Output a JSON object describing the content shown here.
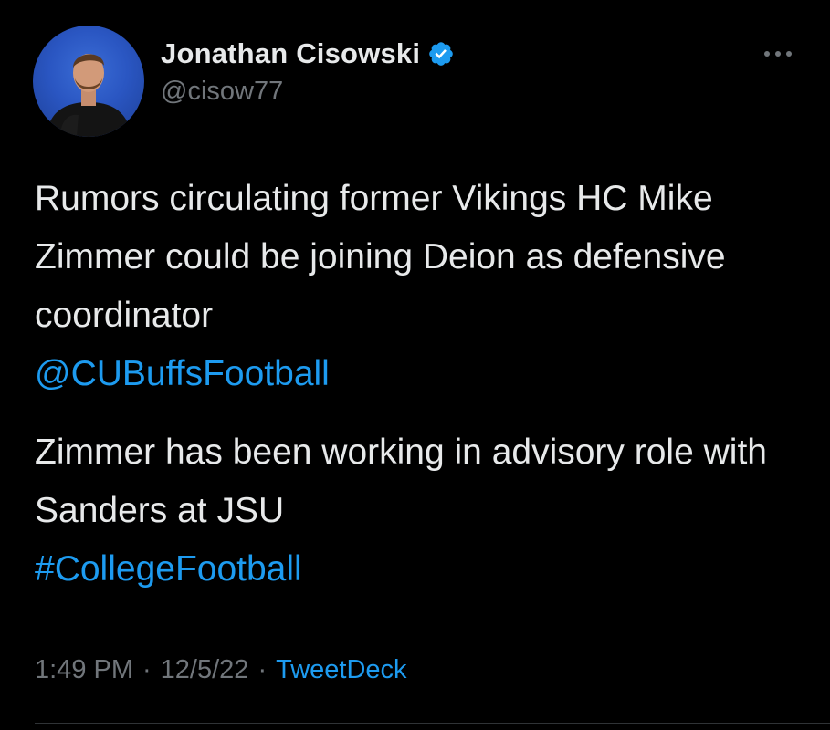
{
  "author": {
    "display_name": "Jonathan Cisowski",
    "handle": "@cisow77",
    "verified": true,
    "avatar_icon": "avatar-photo"
  },
  "tweet": {
    "paragraph1": {
      "text": "Rumors circulating former Vikings HC Mike Zimmer could be joining Deion as defensive coordinator",
      "mention": "@CUBuffsFootball"
    },
    "paragraph2": {
      "text": "Zimmer has been working in advisory role with Sanders at JSU",
      "hashtag": "#CollegeFootball"
    }
  },
  "meta": {
    "time": "1:49 PM",
    "separator": "·",
    "date": "12/5/22",
    "source": "TweetDeck"
  },
  "colors": {
    "background": "#000000",
    "text": "#e7e9ea",
    "secondary": "#71767b",
    "link": "#1d9bf0"
  },
  "icons": {
    "more": "more-horizontal-icon",
    "verified": "verified-badge-icon"
  }
}
